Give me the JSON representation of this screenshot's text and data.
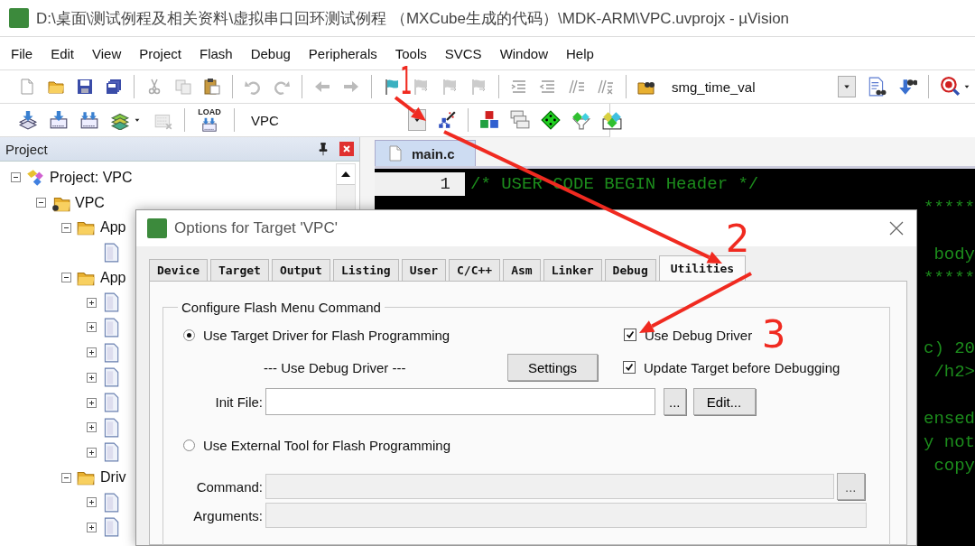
{
  "window": {
    "title": "D:\\桌面\\测试例程及相关资料\\虚拟串口回环测试例程 （MXCube生成的代码）\\MDK-ARM\\VPC.uvprojx - µVision"
  },
  "menu": [
    "File",
    "Edit",
    "View",
    "Project",
    "Flash",
    "Debug",
    "Peripherals",
    "Tools",
    "SVCS",
    "Window",
    "Help"
  ],
  "toolbar": {
    "find_combo": {
      "value": "smg_time_val"
    },
    "target_combo": {
      "value": "VPC"
    },
    "load_label": "LOAD"
  },
  "project_panel": {
    "title": "Project",
    "tree": [
      {
        "label": "Project: VPC",
        "kind": "project",
        "expanded": true,
        "children": [
          {
            "label": "VPC",
            "kind": "target",
            "expanded": true,
            "children": [
              {
                "label": "App",
                "kind": "group",
                "expanded": true,
                "children": [
                  {
                    "kind": "file"
                  }
                ]
              },
              {
                "label": "App",
                "kind": "group",
                "expanded": true,
                "children": [
                  {
                    "kind": "file",
                    "expanded": false
                  },
                  {
                    "kind": "file",
                    "expanded": false
                  },
                  {
                    "kind": "file",
                    "expanded": false
                  },
                  {
                    "kind": "file",
                    "expanded": false
                  },
                  {
                    "kind": "file",
                    "expanded": false
                  },
                  {
                    "kind": "file",
                    "expanded": false
                  },
                  {
                    "kind": "file",
                    "expanded": false
                  }
                ]
              },
              {
                "label": "Driv",
                "kind": "group",
                "expanded": true,
                "children": [
                  {
                    "kind": "file",
                    "expanded": false
                  },
                  {
                    "kind": "file",
                    "expanded": false
                  }
                ]
              }
            ]
          }
        ]
      }
    ]
  },
  "editor": {
    "tabs": [
      {
        "label": "main.c",
        "selected": true
      }
    ],
    "lines": [
      {
        "number": "1",
        "text": "/* USER CODE BEGIN Header */"
      }
    ],
    "right_edge": [
      {
        "kind": "text",
        "text": "*****"
      },
      {
        "kind": "empty"
      },
      {
        "kind": "text",
        "text": "body"
      },
      {
        "kind": "text",
        "text": "*****"
      },
      {
        "kind": "empty"
      },
      {
        "kind": "empty"
      },
      {
        "kind": "text",
        "text": "c) 20"
      },
      {
        "kind": "text",
        "text": "/h2>"
      },
      {
        "kind": "empty"
      },
      {
        "kind": "text",
        "text": "ensed"
      },
      {
        "kind": "text",
        "text": "y not"
      },
      {
        "kind": "text",
        "text": "copy"
      }
    ]
  },
  "dialog": {
    "title": "Options for Target 'VPC'",
    "tabs": [
      {
        "label": "Device",
        "selected": false
      },
      {
        "label": "Target",
        "selected": false
      },
      {
        "label": "Output",
        "selected": false
      },
      {
        "label": "Listing",
        "selected": false
      },
      {
        "label": "User",
        "selected": false
      },
      {
        "label": "C/C++",
        "selected": false
      },
      {
        "label": "Asm",
        "selected": false
      },
      {
        "label": "Linker",
        "selected": false
      },
      {
        "label": "Debug",
        "selected": false
      },
      {
        "label": "Utilities",
        "selected": true
      }
    ],
    "group_title": "Configure Flash Menu Command",
    "flash_source": [
      {
        "label": "Use Target Driver for Flash Programming",
        "selected": true
      },
      {
        "label": "Use External Tool for Flash Programming",
        "selected": false
      }
    ],
    "driver_note": "--- Use Debug Driver ---",
    "settings_button": "Settings",
    "checkboxes": [
      {
        "label": "Use Debug Driver",
        "checked": true
      },
      {
        "label": "Update Target before Debugging",
        "checked": true
      }
    ],
    "init_file": {
      "label": "Init File:",
      "browse": "...",
      "edit": "Edit..."
    },
    "command": {
      "label": "Command:",
      "browse": "...",
      "disabled": true
    },
    "arguments": {
      "label": "Arguments:",
      "disabled": true
    }
  },
  "annotations": [
    {
      "label": "1"
    },
    {
      "label": "2"
    },
    {
      "label": "3"
    }
  ]
}
